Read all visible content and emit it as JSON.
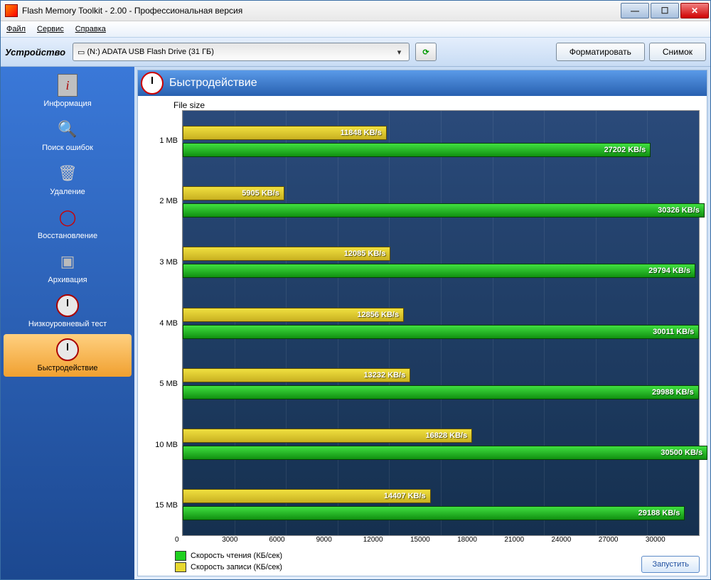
{
  "window_title": "Flash Memory Toolkit - 2.00 - Профессиональная версия",
  "menu": {
    "file": "Файл",
    "service": "Сервис",
    "help": "Справка"
  },
  "toolbar": {
    "device_label": "Устройство",
    "device_value": "(N:) ADATA  USB Flash Drive (31 ГБ)",
    "format_btn": "Форматировать",
    "snapshot_btn": "Снимок"
  },
  "sidebar": {
    "items": [
      {
        "label": "Информация"
      },
      {
        "label": "Поиск ошибок"
      },
      {
        "label": "Удаление"
      },
      {
        "label": "Восстановление"
      },
      {
        "label": "Архивация"
      },
      {
        "label": "Низкоуровневый тест"
      },
      {
        "label": "Быстродействие"
      }
    ]
  },
  "content": {
    "header": "Быстродействие",
    "axis_title": "File size"
  },
  "legend": {
    "read": "Скорость чтения (КБ/сек)",
    "write": "Скорость записи (КБ/сек)"
  },
  "run_btn": "Запустить",
  "chart_data": {
    "type": "bar",
    "categories": [
      "1 MB",
      "2 MB",
      "3 MB",
      "4 MB",
      "5 MB",
      "10 MB",
      "15 MB"
    ],
    "series": [
      {
        "name": "Скорость записи (КБ/сек)",
        "color": "#e8d830",
        "values": [
          11848,
          5905,
          12085,
          12856,
          13232,
          16828,
          14407
        ]
      },
      {
        "name": "Скорость чтения (КБ/сек)",
        "color": "#20d020",
        "values": [
          27202,
          30326,
          29794,
          30011,
          29988,
          30500,
          29188
        ]
      }
    ],
    "xlabel": "",
    "ylabel": "File size",
    "xlim": [
      0,
      30000
    ],
    "xticks": [
      0,
      3000,
      6000,
      9000,
      12000,
      15000,
      18000,
      21000,
      24000,
      27000,
      30000
    ],
    "unit": "KB/s"
  }
}
